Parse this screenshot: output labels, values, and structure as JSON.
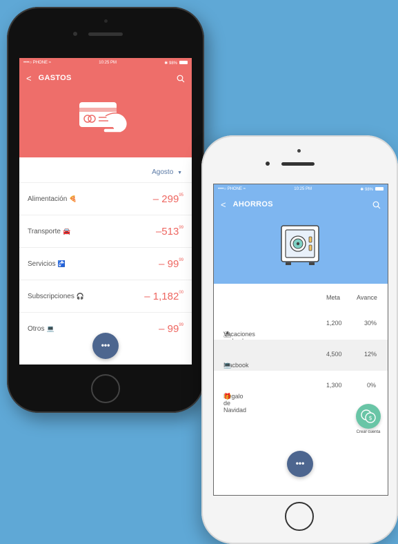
{
  "gastos": {
    "status": {
      "carrier": "••••○ PHONE ≈",
      "time": "10:25 PM",
      "battery": "✱ 98%"
    },
    "title": "GASTOS",
    "header_color": "#ee6e6a",
    "month": "Agosto",
    "items": [
      {
        "label": "Alimentación",
        "emoji": "🍕",
        "amount": "– 299",
        "cents": "95"
      },
      {
        "label": "Transporte",
        "emoji": "🚘",
        "amount": "–513",
        "cents": "99"
      },
      {
        "label": "Servicios",
        "emoji": "🚰",
        "amount": "– 99",
        "cents": "99"
      },
      {
        "label": "Subscripciones",
        "emoji": "🎧",
        "amount": "– 1,182",
        "cents": "00"
      },
      {
        "label": "Otros",
        "emoji": "💻",
        "amount": "– 99",
        "cents": "99"
      }
    ],
    "fab_label": "•••"
  },
  "ahorros": {
    "status": {
      "carrier": "••••○ PHONE ≈",
      "time": "10:25 PM",
      "battery": "✱ 98%"
    },
    "title": "AHORROS",
    "header_color": "#7eb6f0",
    "columns": {
      "meta": "Meta",
      "avance": "Avance"
    },
    "rows": [
      {
        "label": "Vacaciones en la playa",
        "emoji": "⛱",
        "meta": "1,200",
        "avance": "30%"
      },
      {
        "label": "Macbook",
        "emoji": "💻",
        "meta": "4,500",
        "avance": "12%"
      },
      {
        "label": "Regalo de Navidad",
        "emoji": "🎁",
        "meta": "1,300",
        "avance": "0%"
      }
    ],
    "create_account_label": "Crear cuenta",
    "fab_label": "•••"
  }
}
